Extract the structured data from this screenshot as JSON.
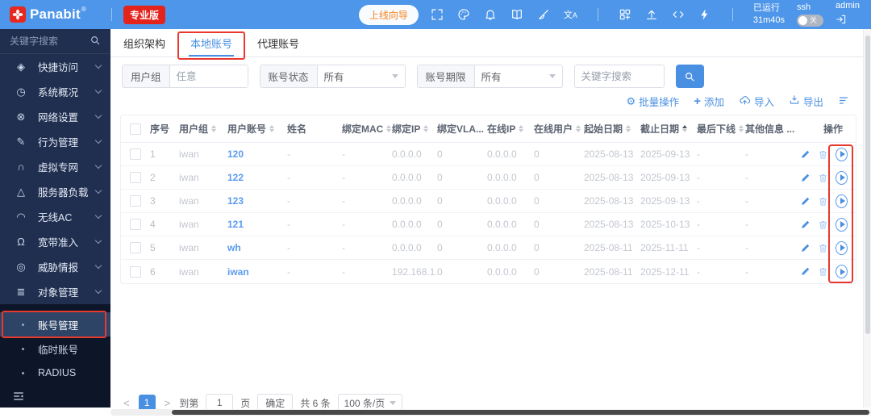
{
  "theme": {
    "brand_blue": "#4e96e9",
    "accent_blue": "#4a90e2",
    "badge_red": "#e4231c",
    "annotation_red": "#e8392f",
    "sidebar_navy": "#202f50",
    "sidebar_dark": "#0d1628"
  },
  "header": {
    "brand": "Panabit",
    "registered_mark": "®",
    "edition_badge": "专业版",
    "wizard_button": "上线向导",
    "icon_group_1": [
      "fullscreen",
      "palette",
      "bell",
      "book",
      "broom",
      "translate"
    ],
    "icon_group_2": [
      "apps-grid",
      "upgrade",
      "code",
      "lightning"
    ],
    "uptime_label": "已运行",
    "uptime_value": "31m40s",
    "ssh_label": "ssh",
    "ssh_toggle_state": "关",
    "username": "admin"
  },
  "sidebar": {
    "search_placeholder": "关键字搜索",
    "items": [
      {
        "id": "quick-access",
        "icon": "gem",
        "label": "快捷访问"
      },
      {
        "id": "system-overview",
        "icon": "gauge",
        "label": "系统概况"
      },
      {
        "id": "network-settings",
        "icon": "network",
        "label": "网络设置"
      },
      {
        "id": "behavior-mgmt",
        "icon": "pen",
        "label": "行为管理"
      },
      {
        "id": "vpn",
        "icon": "magnet",
        "label": "虚拟专网"
      },
      {
        "id": "server-load",
        "icon": "nodes",
        "label": "服务器负载"
      },
      {
        "id": "wireless-ac",
        "icon": "wifi",
        "label": "无线AC"
      },
      {
        "id": "broadband-access",
        "icon": "user",
        "label": "宽带准入"
      },
      {
        "id": "threat-intel",
        "icon": "target",
        "label": "威胁情报"
      },
      {
        "id": "object-mgmt",
        "icon": "database",
        "label": "对象管理"
      }
    ],
    "submenu": [
      {
        "id": "account-mgmt",
        "label": "账号管理",
        "active": true
      },
      {
        "id": "temp-account",
        "label": "临时账号",
        "active": false
      },
      {
        "id": "radius",
        "label": "RADIUS",
        "active": false
      }
    ]
  },
  "tabs": [
    {
      "id": "org-structure",
      "label": "组织架构",
      "active": false
    },
    {
      "id": "local-account",
      "label": "本地账号",
      "active": true
    },
    {
      "id": "proxy-account",
      "label": "代理账号",
      "active": false
    }
  ],
  "filters": {
    "group_label": "用户组",
    "group_value": "任意",
    "status_label": "账号状态",
    "status_value": "所有",
    "period_label": "账号期限",
    "period_value": "所有",
    "keyword_placeholder": "关键字搜索"
  },
  "toolbar": {
    "batch": "批量操作",
    "add": "添加",
    "import": "导入",
    "export": "导出"
  },
  "table": {
    "columns": [
      {
        "id": "no",
        "label": "序号",
        "sort": false
      },
      {
        "id": "group",
        "label": "用户组",
        "sort": true
      },
      {
        "id": "account",
        "label": "用户账号",
        "sort": true
      },
      {
        "id": "name",
        "label": "姓名",
        "sort": false
      },
      {
        "id": "mac",
        "label": "绑定MAC",
        "sort": true
      },
      {
        "id": "bind-ip",
        "label": "绑定IP",
        "sort": true
      },
      {
        "id": "vlan",
        "label": "绑定VLA...",
        "sort": true
      },
      {
        "id": "online-ip",
        "label": "在线IP",
        "sort": true
      },
      {
        "id": "online-users",
        "label": "在线用户",
        "sort": true
      },
      {
        "id": "start-date",
        "label": "起始日期",
        "sort": true
      },
      {
        "id": "end-date",
        "label": "截止日期",
        "sort": true,
        "sorted": "asc"
      },
      {
        "id": "last-offline",
        "label": "最后下线",
        "sort": true
      },
      {
        "id": "other-info",
        "label": "其他信息 ...",
        "sort": false
      },
      {
        "id": "actions",
        "label": "操作",
        "sort": false
      }
    ],
    "rows": [
      {
        "no": "1",
        "group": "iwan",
        "account": "120",
        "name": "-",
        "mac": "-",
        "bind_ip": "0.0.0.0",
        "vlan": "0",
        "online_ip": "0.0.0.0",
        "online_users": "0",
        "start": "2025-08-13",
        "end": "2025-09-13",
        "last_offline": "-",
        "other": "-"
      },
      {
        "no": "2",
        "group": "iwan",
        "account": "122",
        "name": "-",
        "mac": "-",
        "bind_ip": "0.0.0.0",
        "vlan": "0",
        "online_ip": "0.0.0.0",
        "online_users": "0",
        "start": "2025-08-13",
        "end": "2025-09-13",
        "last_offline": "-",
        "other": "-"
      },
      {
        "no": "3",
        "group": "iwan",
        "account": "123",
        "name": "-",
        "mac": "-",
        "bind_ip": "0.0.0.0",
        "vlan": "0",
        "online_ip": "0.0.0.0",
        "online_users": "0",
        "start": "2025-08-13",
        "end": "2025-09-13",
        "last_offline": "-",
        "other": "-"
      },
      {
        "no": "4",
        "group": "iwan",
        "account": "121",
        "name": "-",
        "mac": "-",
        "bind_ip": "0.0.0.0",
        "vlan": "0",
        "online_ip": "0.0.0.0",
        "online_users": "0",
        "start": "2025-08-13",
        "end": "2025-10-13",
        "last_offline": "-",
        "other": "-"
      },
      {
        "no": "5",
        "group": "iwan",
        "account": "wh",
        "name": "-",
        "mac": "-",
        "bind_ip": "0.0.0.0",
        "vlan": "0",
        "online_ip": "0.0.0.0",
        "online_users": "0",
        "start": "2025-08-11",
        "end": "2025-11-11",
        "last_offline": "-",
        "other": "-"
      },
      {
        "no": "6",
        "group": "iwan",
        "account": "iwan",
        "name": "-",
        "mac": "-",
        "bind_ip": "192.168.1...",
        "vlan": "0",
        "online_ip": "0.0.0.0",
        "online_users": "0",
        "start": "2025-08-11",
        "end": "2025-12-11",
        "last_offline": "-",
        "other": "-"
      }
    ]
  },
  "pagination": {
    "prev": "<",
    "current_page": "1",
    "next": ">",
    "goto_prefix": "到第",
    "goto_value": "1",
    "goto_suffix": "页",
    "confirm": "确定",
    "total": "共 6 条",
    "page_size": "100 条/页"
  },
  "annotations": {
    "color": "#e8392f",
    "marked": [
      "tab-local-account",
      "sidebar-subitem-account-mgmt",
      "play-button-column"
    ]
  }
}
